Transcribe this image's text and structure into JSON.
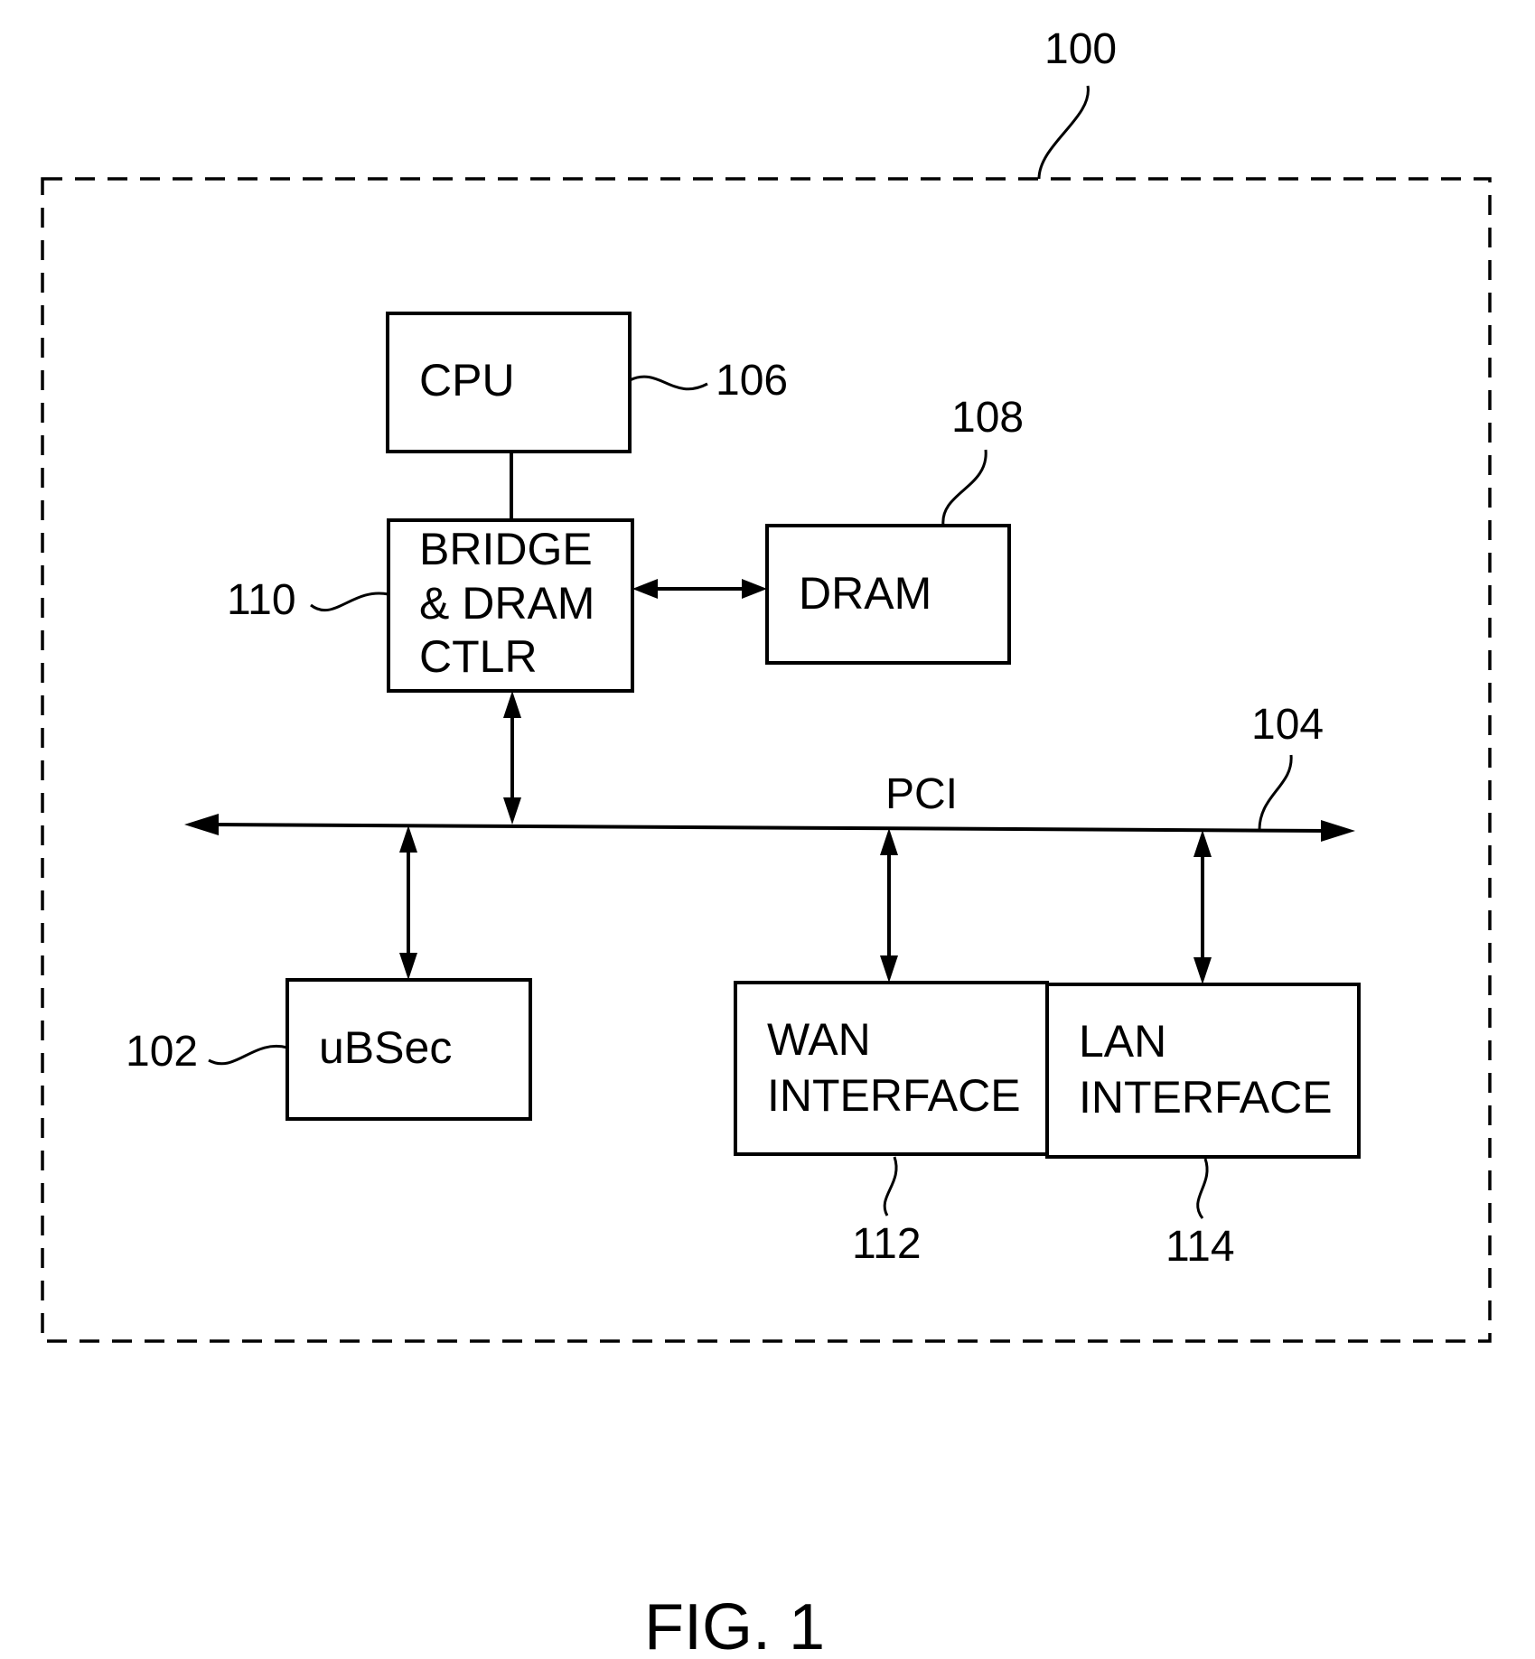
{
  "figure": {
    "caption": "FIG. 1",
    "system_ref": "100"
  },
  "blocks": {
    "cpu": {
      "lines": [
        "CPU"
      ],
      "ref": "106"
    },
    "bridge": {
      "lines": [
        "BRIDGE",
        "& DRAM",
        "CTLR"
      ],
      "ref": "110"
    },
    "dram": {
      "lines": [
        "DRAM"
      ],
      "ref": "108"
    },
    "ubsec": {
      "lines": [
        "uBSec"
      ],
      "ref": "102"
    },
    "wan": {
      "lines": [
        "WAN",
        "INTERFACE"
      ],
      "ref": "112"
    },
    "lan": {
      "lines": [
        "LAN",
        "INTERFACE"
      ],
      "ref": "114"
    }
  },
  "bus": {
    "label": "PCI",
    "ref": "104"
  }
}
